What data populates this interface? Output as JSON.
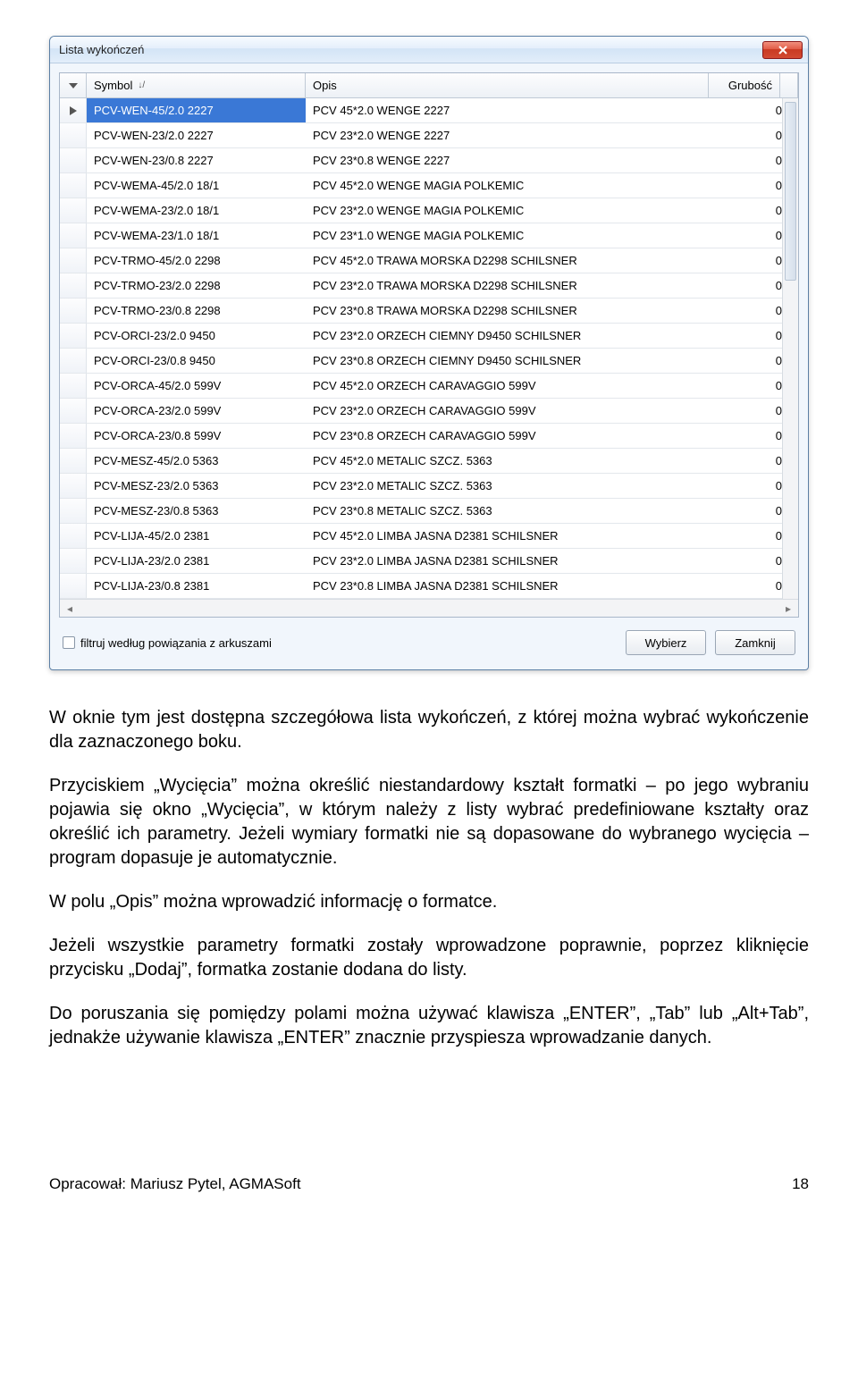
{
  "dialog": {
    "title": "Lista wykończeń",
    "columns": {
      "symbol": "Symbol",
      "opis": "Opis",
      "grubosc": "Grubość",
      "sort_marker": "↓/"
    },
    "rows": [
      {
        "symbol": "PCV-WEN-45/2.0 2227",
        "opis": "PCV 45*2.0 WENGE 2227",
        "grubosc": "0",
        "selected": true
      },
      {
        "symbol": "PCV-WEN-23/2.0 2227",
        "opis": "PCV 23*2.0 WENGE 2227",
        "grubosc": "0"
      },
      {
        "symbol": "PCV-WEN-23/0.8 2227",
        "opis": "PCV 23*0.8 WENGE 2227",
        "grubosc": "0"
      },
      {
        "symbol": "PCV-WEMA-45/2.0 18/1",
        "opis": "PCV 45*2.0 WENGE MAGIA POLKEMIC",
        "grubosc": "0"
      },
      {
        "symbol": "PCV-WEMA-23/2.0 18/1",
        "opis": "PCV 23*2.0 WENGE MAGIA POLKEMIC",
        "grubosc": "0"
      },
      {
        "symbol": "PCV-WEMA-23/1.0 18/1",
        "opis": "PCV 23*1.0 WENGE MAGIA POLKEMIC",
        "grubosc": "0"
      },
      {
        "symbol": "PCV-TRMO-45/2.0 2298",
        "opis": "PCV 45*2.0 TRAWA MORSKA D2298  SCHILSNER",
        "grubosc": "0"
      },
      {
        "symbol": "PCV-TRMO-23/2.0 2298",
        "opis": "PCV 23*2.0 TRAWA MORSKA D2298  SCHILSNER",
        "grubosc": "0"
      },
      {
        "symbol": "PCV-TRMO-23/0.8 2298",
        "opis": "PCV 23*0.8 TRAWA MORSKA D2298  SCHILSNER",
        "grubosc": "0"
      },
      {
        "symbol": "PCV-ORCI-23/2.0 9450",
        "opis": "PCV 23*2.0 ORZECH CIEMNY D9450 SCHILSNER",
        "grubosc": "0"
      },
      {
        "symbol": "PCV-ORCI-23/0.8 9450",
        "opis": "PCV 23*0.8 ORZECH CIEMNY D9450 SCHILSNER",
        "grubosc": "0"
      },
      {
        "symbol": "PCV-ORCA-45/2.0 599V",
        "opis": "PCV 45*2.0 ORZECH CARAVAGGIO 599V",
        "grubosc": "0"
      },
      {
        "symbol": "PCV-ORCA-23/2.0 599V",
        "opis": "PCV 23*2.0 ORZECH CARAVAGGIO 599V",
        "grubosc": "0"
      },
      {
        "symbol": "PCV-ORCA-23/0.8 599V",
        "opis": "PCV 23*0.8 ORZECH CARAVAGGIO 599V",
        "grubosc": "0"
      },
      {
        "symbol": "PCV-MESZ-45/2.0 5363",
        "opis": "PCV 45*2.0 METALIC SZCZ. 5363",
        "grubosc": "0"
      },
      {
        "symbol": "PCV-MESZ-23/2.0 5363",
        "opis": "PCV 23*2.0 METALIC SZCZ. 5363",
        "grubosc": "0"
      },
      {
        "symbol": "PCV-MESZ-23/0.8 5363",
        "opis": "PCV 23*0.8 METALIC SZCZ. 5363",
        "grubosc": "0"
      },
      {
        "symbol": "PCV-LIJA-45/2.0 2381",
        "opis": "PCV 45*2.0 LIMBA JASNA D2381  SCHILSNER",
        "grubosc": "0"
      },
      {
        "symbol": "PCV-LIJA-23/2.0 2381",
        "opis": "PCV 23*2.0 LIMBA JASNA D2381  SCHILSNER",
        "grubosc": "0"
      },
      {
        "symbol": "PCV-LIJA-23/0.8 2381",
        "opis": "PCV 23*0.8 LIMBA JASNA D2381  SCHILSNER",
        "grubosc": "0"
      }
    ],
    "filter_label": "filtruj według powiązania z arkuszami",
    "buttons": {
      "wybierz": "Wybierz",
      "zamknij": "Zamknij"
    }
  },
  "body": {
    "p1": "W oknie tym jest dostępna szczegółowa lista wykończeń, z której można wybrać wykończenie dla zaznaczonego boku.",
    "p2": "Przyciskiem „Wycięcia” można określić niestandardowy kształt formatki – po jego wybraniu pojawia się okno „Wycięcia”, w którym należy z listy wybrać predefiniowane kształty oraz określić ich parametry. Jeżeli wymiary formatki nie są dopasowane do wybranego wycięcia – program dopasuje je automatycznie.",
    "p3": "W polu „Opis” można wprowadzić informację o formatce.",
    "p4": "Jeżeli wszystkie parametry formatki zostały wprowadzone poprawnie, poprzez kliknięcie przycisku „Dodaj”, formatka zostanie dodana do listy.",
    "p5": "Do poruszania się pomiędzy polami można używać klawisza „ENTER”, „Tab” lub „Alt+Tab”, jednakże używanie klawisza „ENTER” znacznie przyspiesza wprowadzanie danych."
  },
  "footer": {
    "left": "Opracował: Mariusz Pytel, AGMASoft",
    "right": "18"
  }
}
